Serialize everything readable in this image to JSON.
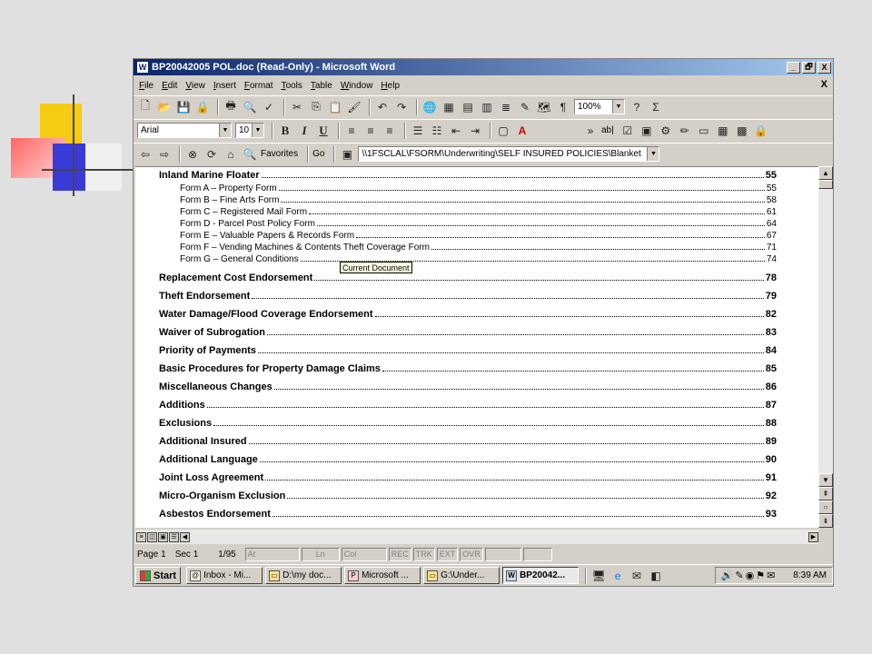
{
  "window": {
    "title": "BP20042005 POL.doc (Read-Only) - Microsoft Word",
    "controls": [
      "_",
      "🗗",
      "X"
    ]
  },
  "menubar": {
    "items": [
      "File",
      "Edit",
      "View",
      "Insert",
      "Format",
      "Tools",
      "Table",
      "Window",
      "Help"
    ],
    "close_doc": "X"
  },
  "toolbar_standard": {
    "zoom": "100%"
  },
  "toolbar_formatting": {
    "font": "Arial",
    "size": "10",
    "bold": "B",
    "italic": "I",
    "underline": "U",
    "text_box_label": "ab|"
  },
  "toolbar_web": {
    "favorites": "Favorites",
    "go": "Go",
    "address": "\\\\1FSCLAL\\FSORM\\Underwriting\\SELF INSURED POLICIES\\Blanket"
  },
  "document": {
    "toc": [
      {
        "title": "Inland Marine Floater",
        "page": "55",
        "level": "main"
      },
      {
        "title": "Form A – Property Form",
        "page": "55",
        "level": "sub"
      },
      {
        "title": "Form B – Fine Arts Form",
        "page": "58",
        "level": "sub"
      },
      {
        "title": "Form C – Registered Mail Form",
        "page": "61",
        "level": "sub"
      },
      {
        "title": "Form D - Parcel Post Policy Form",
        "page": "64",
        "level": "sub"
      },
      {
        "title": "Form E – Valuable Papers & Records Form",
        "page": "67",
        "level": "sub"
      },
      {
        "title": "Form F – Vending Machines & Contents Theft Coverage Form",
        "page": "71",
        "level": "sub"
      },
      {
        "title": "Form G – General Conditions",
        "page": "74",
        "level": "sub"
      },
      {
        "title": "Replacement Cost Endorsement",
        "page": "78",
        "level": "main"
      },
      {
        "title": "Theft Endorsement",
        "page": "79",
        "level": "main"
      },
      {
        "title": "Water Damage/Flood Coverage Endorsement",
        "page": "82",
        "level": "main"
      },
      {
        "title": "Waiver of Subrogation",
        "page": "83",
        "level": "main"
      },
      {
        "title": "Priority of Payments",
        "page": "84",
        "level": "main"
      },
      {
        "title": "Basic Procedures for Property Damage Claims",
        "page": "85",
        "level": "main"
      },
      {
        "title": "Miscellaneous Changes",
        "page": "86",
        "level": "main"
      },
      {
        "title": "Additions",
        "page": "87",
        "level": "main"
      },
      {
        "title": "Exclusions",
        "page": "88",
        "level": "main"
      },
      {
        "title": "Additional Insured",
        "page": "89",
        "level": "main"
      },
      {
        "title": "Additional Language",
        "page": "90",
        "level": "main"
      },
      {
        "title": "Joint Loss Agreement",
        "page": "91",
        "level": "main"
      },
      {
        "title": "Micro-Organism Exclusion",
        "page": "92",
        "level": "main"
      },
      {
        "title": "Asbestos Endorsement",
        "page": "93",
        "level": "main"
      }
    ],
    "tooltip": "Current Document"
  },
  "statusbar": {
    "page": "Page 1",
    "sec": "Sec 1",
    "pages": "1/95",
    "at": "At",
    "ln": "Ln",
    "col": "Col",
    "rec": "REC",
    "trk": "TRK",
    "ext": "EXT",
    "ovr": "OVR"
  },
  "taskbar": {
    "start": "Start",
    "buttons": [
      {
        "label": "Inbox - Mi...",
        "active": false
      },
      {
        "label": "D:\\my doc...",
        "active": false
      },
      {
        "label": "Microsoft ...",
        "active": false
      },
      {
        "label": "G:\\Under...",
        "active": false
      },
      {
        "label": "BP20042...",
        "active": true
      }
    ],
    "clock": "8:39 AM"
  }
}
